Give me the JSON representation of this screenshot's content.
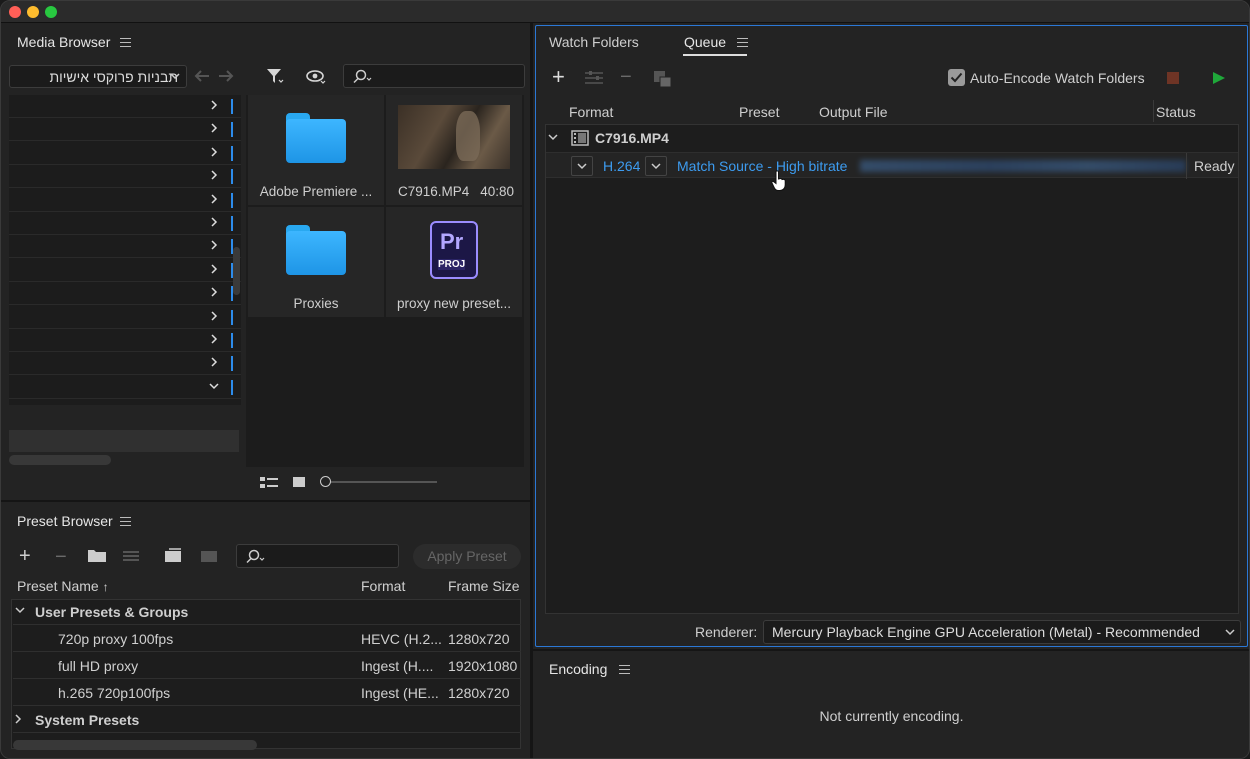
{
  "media_browser": {
    "title": "Media Browser",
    "location_select": "תבניות פרוקסי אישיות",
    "tree_rows": 13,
    "tiles": [
      {
        "label": "Adobe Premiere ...",
        "kind": "folder"
      },
      {
        "label": "C7916.MP4",
        "duration": "40:80",
        "kind": "video"
      },
      {
        "label": "Proxies",
        "kind": "folder"
      },
      {
        "label": "proxy new preset...",
        "kind": "project",
        "icon_text": "Pr",
        "icon_sub": "PROJ"
      }
    ]
  },
  "preset_browser": {
    "title": "Preset Browser",
    "apply_label": "Apply Preset",
    "columns": {
      "name": "Preset Name",
      "format": "Format",
      "frame_size": "Frame Size"
    },
    "group_user": "User Presets & Groups",
    "group_system": "System Presets",
    "rows": [
      {
        "name": "720p proxy 100fps",
        "format": "HEVC (H.2...",
        "frame_size": "1280x720"
      },
      {
        "name": "full HD proxy",
        "format": "Ingest (H....",
        "frame_size": "1920x1080"
      },
      {
        "name": "h.265 720p100fps",
        "format": "Ingest (HE...",
        "frame_size": "1280x720"
      }
    ]
  },
  "queue": {
    "tabs": {
      "watch": "Watch Folders",
      "queue": "Queue"
    },
    "auto_encode_label": "Auto-Encode Watch Folders",
    "columns": {
      "format": "Format",
      "preset": "Preset",
      "output": "Output File",
      "status": "Status"
    },
    "source_name": "C7916.MP4",
    "item": {
      "format": "H.264",
      "preset": "Match Source - High bitrate",
      "status": "Ready"
    },
    "renderer_label": "Renderer:",
    "renderer_value": "Mercury Playback Engine GPU Acceleration (Metal) - Recommended"
  },
  "encoding": {
    "title": "Encoding",
    "status": "Not currently encoding."
  },
  "colors": {
    "accent": "#2b78d6",
    "link": "#3d9cf0",
    "folder": "#29a8f0",
    "play": "#1fa83a",
    "stop": "#7a3a2a"
  }
}
